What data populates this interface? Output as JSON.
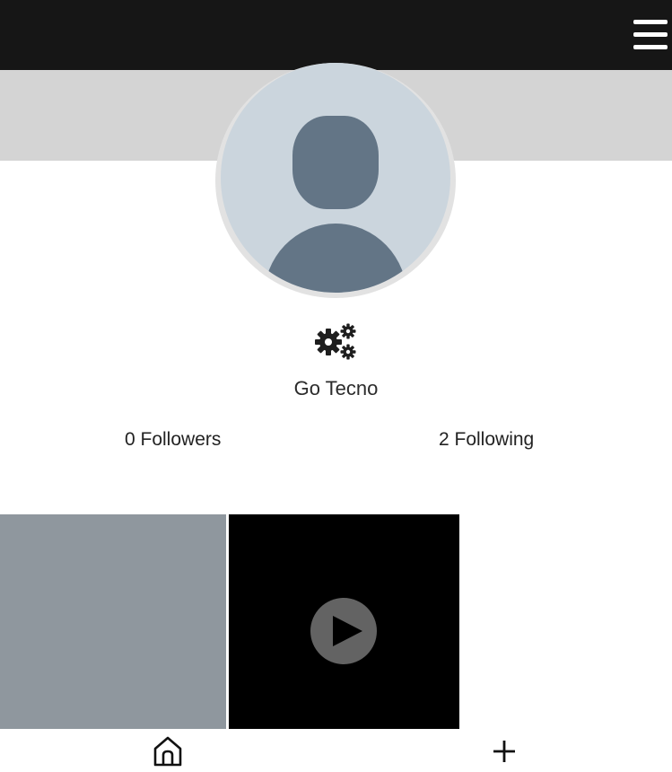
{
  "header": {
    "menu_icon": "hamburger-menu-icon"
  },
  "profile": {
    "avatar_icon": "default-avatar-icon",
    "settings_icon": "gears-icon",
    "name": "Go Tecno",
    "followers_label": "0 Followers",
    "following_label": "2 Following"
  },
  "posts": {
    "items": [
      {
        "kind": "image"
      },
      {
        "kind": "video",
        "icon": "play-icon"
      }
    ]
  },
  "bottom_nav": {
    "home_icon": "home-icon",
    "add_icon": "plus-icon"
  },
  "colors": {
    "topbar": "#161616",
    "cover": "#d4d4d4",
    "avatar_bg": "#cbd5dd",
    "avatar_figure": "#637586",
    "image_tile": "#8f979e",
    "video_tile": "#000000"
  }
}
